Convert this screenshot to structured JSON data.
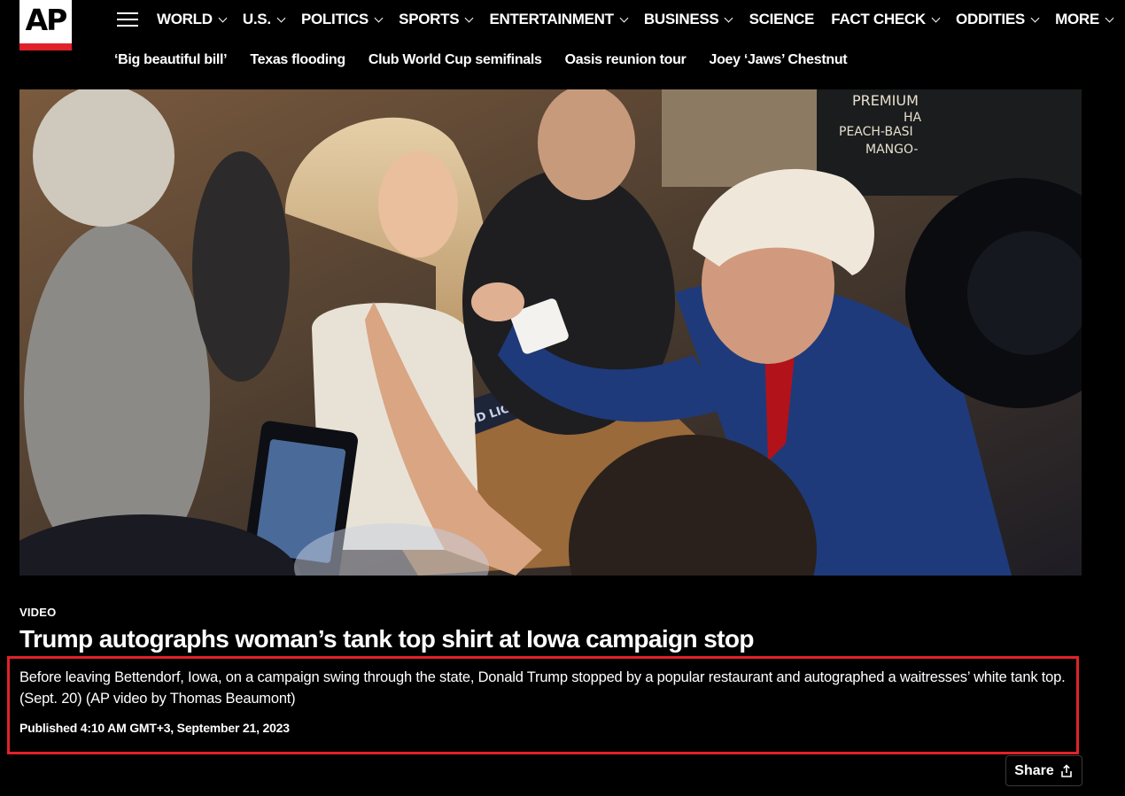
{
  "header": {
    "logo_text": "AP",
    "menu_icon": "hamburger-menu-icon",
    "nav": [
      {
        "label": "WORLD",
        "has_dropdown": true
      },
      {
        "label": "U.S.",
        "has_dropdown": true
      },
      {
        "label": "POLITICS",
        "has_dropdown": true
      },
      {
        "label": "SPORTS",
        "has_dropdown": true
      },
      {
        "label": "ENTERTAINMENT",
        "has_dropdown": true
      },
      {
        "label": "BUSINESS",
        "has_dropdown": true
      },
      {
        "label": "SCIENCE",
        "has_dropdown": false
      },
      {
        "label": "FACT CHECK",
        "has_dropdown": true
      },
      {
        "label": "ODDITIES",
        "has_dropdown": true
      },
      {
        "label": "MORE",
        "has_dropdown": true
      }
    ],
    "trending": [
      "‘Big beautiful bill’",
      "Texas flooding",
      "Club World Cup semifinals",
      "Oasis reunion tour",
      "Joey ‘Jaws’ Chestnut"
    ]
  },
  "media": {
    "kind": "video-still",
    "chalkboard_lines": [
      "PREMIUM",
      "HA",
      "PEACH-BASI",
      "MANGO-"
    ],
    "table_sign_text": "BUD LIG"
  },
  "article": {
    "label": "VIDEO",
    "headline": "Trump autographs woman’s tank top shirt at Iowa campaign stop",
    "description": "Before leaving Bettendorf, Iowa, on a campaign swing through the state, Donald Trump stopped by a popular restaurant and autographed a waitresses’ white tank top. (Sept. 20) (AP video by Thomas Beaumont)",
    "published": "Published 4:10 AM GMT+3, September 21, 2023"
  },
  "share": {
    "label": "Share",
    "icon": "share-icon"
  },
  "colors": {
    "background": "#000000",
    "text": "#ffffff",
    "highlight_border": "#e1222a",
    "logo_accent": "#e0202a"
  }
}
